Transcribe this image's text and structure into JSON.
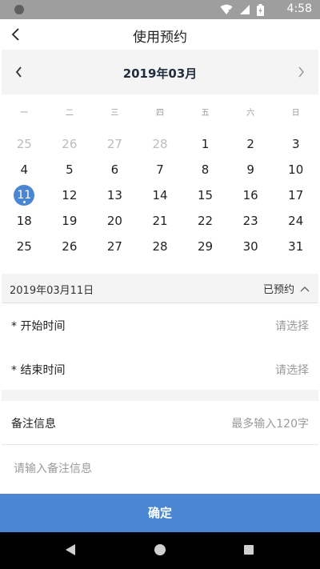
{
  "status_bar": {
    "time": "4:58"
  },
  "header": {
    "title": "使用预约"
  },
  "calendar": {
    "month_title": "2019年03月",
    "weekdays": [
      "一",
      "二",
      "三",
      "四",
      "五",
      "六",
      "日"
    ],
    "days": [
      "25",
      "26",
      "27",
      "28",
      "1",
      "2",
      "3",
      "4",
      "5",
      "6",
      "7",
      "8",
      "9",
      "10",
      "11",
      "12",
      "13",
      "14",
      "15",
      "16",
      "17",
      "18",
      "19",
      "20",
      "21",
      "22",
      "23",
      "24",
      "25",
      "26",
      "27",
      "28",
      "29",
      "30",
      "31"
    ],
    "selected_day": "11"
  },
  "selected_date": {
    "date": "2019年03月11日",
    "status": "已预约"
  },
  "form": {
    "start_label": "* 开始时间",
    "start_value": "请选择",
    "end_label": "* 结束时间",
    "end_value": "请选择",
    "note_label": "备注信息",
    "note_hint": "最多输入120字",
    "note_placeholder": "请输入备注信息"
  },
  "confirm_label": "确定",
  "colors": {
    "accent": "#4a86d1",
    "muted_text": "#9a9a9a",
    "section_bg": "#f4f4f5"
  }
}
